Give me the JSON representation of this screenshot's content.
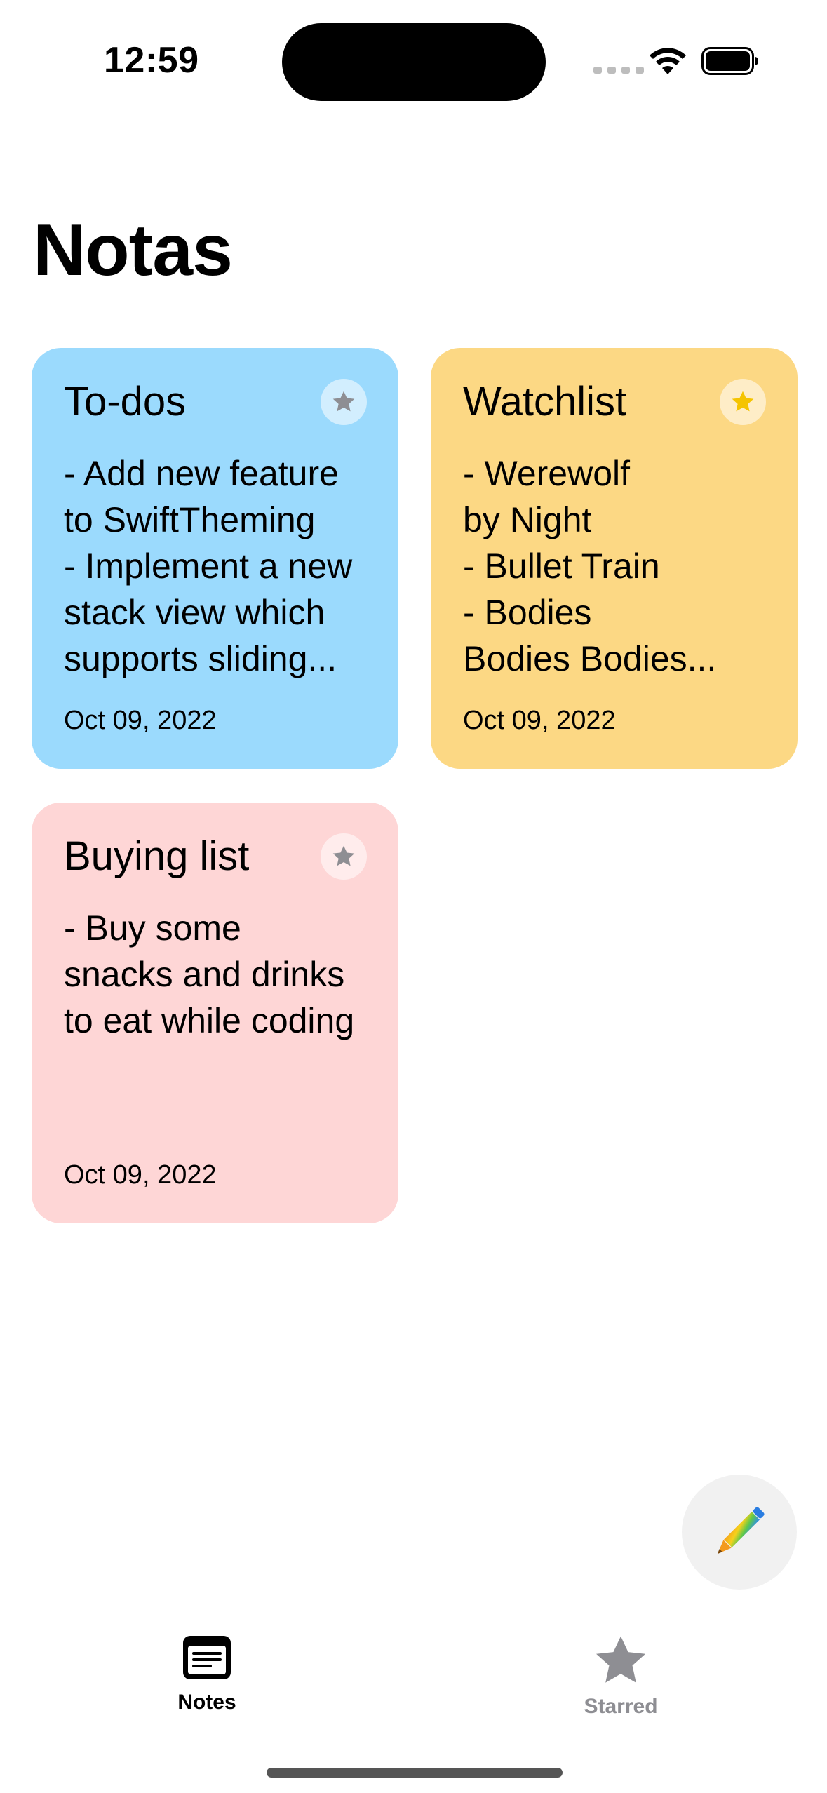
{
  "status_bar": {
    "time": "12:59"
  },
  "page": {
    "title": "Notas"
  },
  "notes": [
    {
      "title": "To-dos",
      "body_lines": [
        "- Add new feature",
        "to SwiftTheming",
        "- Implement a new",
        "stack view which",
        "supports sliding..."
      ],
      "date": "Oct 09, 2022",
      "starred": false,
      "color": "#9bdafd"
    },
    {
      "title": "Watchlist",
      "body_lines": [
        "- Werewolf",
        "by Night",
        "- Bullet Train",
        "- Bodies",
        "Bodies Bodies..."
      ],
      "date": "Oct 09, 2022",
      "starred": true,
      "color": "#fcd884"
    },
    {
      "title": "Buying list",
      "body_lines": [
        "- Buy some",
        "snacks and drinks",
        "to eat while coding"
      ],
      "date": "Oct 09, 2022",
      "starred": false,
      "color": "#fed6d6"
    }
  ],
  "fab": {
    "icon": "pencil-icon"
  },
  "tab_bar": {
    "tabs": [
      {
        "label": "Notes",
        "icon": "note-icon",
        "selected": true
      },
      {
        "label": "Starred",
        "icon": "star-icon",
        "selected": false
      }
    ]
  },
  "colors": {
    "star_inactive": "#8e8e93",
    "star_active": "#f5c400",
    "tab_selected": "#000000",
    "tab_unselected": "#8e8e93"
  }
}
